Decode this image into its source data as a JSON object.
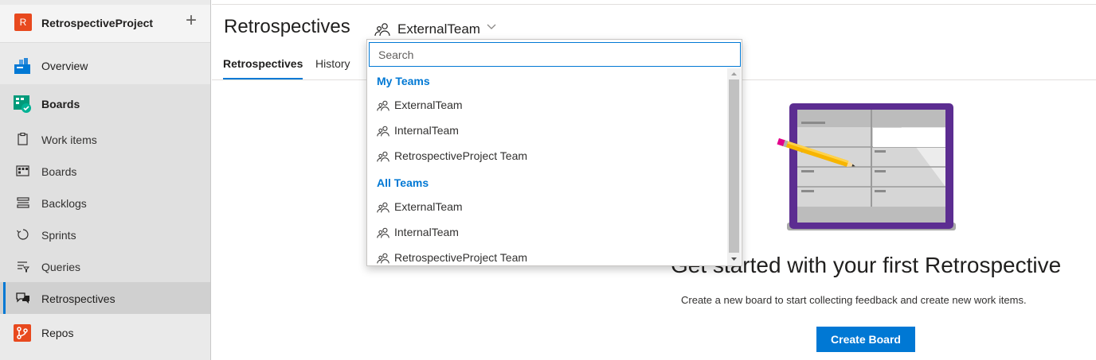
{
  "sidebar": {
    "project": {
      "initial": "R",
      "name": "RetrospectiveProject",
      "add_glyph": "+"
    },
    "overview": {
      "label": "Overview",
      "icon": "overview-icon"
    },
    "boards_hub": {
      "label": "Boards",
      "icon": "boards-hub-icon"
    },
    "items": [
      {
        "label": "Work items",
        "icon": "work-items-icon"
      },
      {
        "label": "Boards",
        "icon": "boards-icon"
      },
      {
        "label": "Backlogs",
        "icon": "backlogs-icon"
      },
      {
        "label": "Sprints",
        "icon": "sprints-icon"
      },
      {
        "label": "Queries",
        "icon": "queries-icon"
      },
      {
        "label": "Retrospectives",
        "icon": "retrospectives-icon",
        "active": true
      }
    ],
    "repos": {
      "label": "Repos",
      "icon": "repos-icon"
    }
  },
  "header": {
    "title": "Retrospectives",
    "team_selected": "ExternalTeam",
    "tabs": [
      {
        "label": "Retrospectives",
        "active": true
      },
      {
        "label": "History",
        "active": false
      }
    ]
  },
  "dropdown": {
    "search_placeholder": "Search",
    "my_teams_header": "My Teams",
    "my_teams": [
      "ExternalTeam",
      "InternalTeam",
      "RetrospectiveProject Team"
    ],
    "all_teams_header": "All Teams",
    "all_teams": [
      "ExternalTeam",
      "InternalTeam",
      "RetrospectiveProject Team"
    ]
  },
  "empty_state": {
    "title": "Get started with your first Retrospective",
    "description": "Create a new board to start collecting feedback and create new work items.",
    "button": "Create Board"
  },
  "colors": {
    "accent": "#0078d4",
    "project_avatar": "#e8491e",
    "illustration_frame": "#5c2d91"
  }
}
